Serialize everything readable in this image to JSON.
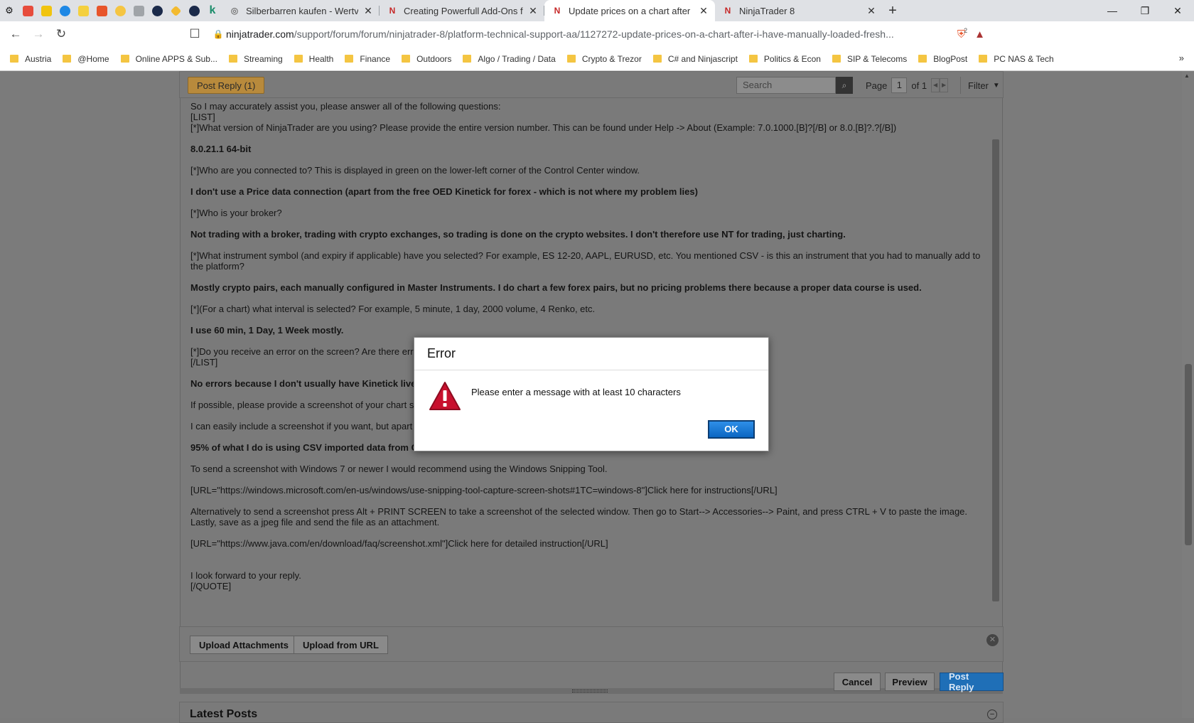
{
  "tabs": [
    {
      "title": "Silberbarren kaufen - Wertvolle Sil",
      "active": false
    },
    {
      "title": "Creating Powerfull Add-Ons for Ni",
      "active": false
    },
    {
      "title": "Update prices on a chart after I ha",
      "active": true
    },
    {
      "title": "NinjaTrader 8",
      "active": false
    }
  ],
  "omnibox": {
    "host": "ninjatrader.com",
    "path": "/support/forum/forum/ninjatrader-8/platform-technical-support-aa/1127272-update-prices-on-a-chart-after-i-have-manually-loaded-fresh...",
    "brave_count": "2"
  },
  "bookmarks": [
    "Austria",
    "@Home",
    "Online APPS & Sub...",
    "Streaming",
    "Health",
    "Finance",
    "Outdoors",
    "Algo / Trading / Data",
    "Crypto & Trezor",
    "C# and Ninjascript",
    "Politics & Econ",
    "SIP & Telecoms",
    "BlogPost",
    "PC NAS & Tech"
  ],
  "forum": {
    "post_reply_tab": "Post Reply (1)",
    "search_placeholder": "Search",
    "page_label": "Page",
    "page_current": "1",
    "page_of": "of 1",
    "filter_label": "Filter"
  },
  "editor_lines": [
    {
      "text": "So I may accurately assist you, please answer all of the following questions:",
      "bold": false,
      "gap": false
    },
    {
      "text": "[LIST]",
      "bold": false,
      "gap": false
    },
    {
      "text": "[*]What version of NinjaTrader are you using? Please provide the entire version number. This can be found under Help -> About (Example: 7.0.1000.[B]?[/B] or 8.0.[B]?.?[/B])",
      "bold": false,
      "gap": true
    },
    {
      "text": "8.0.21.1 64-bit",
      "bold": true,
      "gap": true
    },
    {
      "text": "[*]Who are you connected to? This is displayed in green on the lower-left corner of the Control Center window.",
      "bold": false,
      "gap": true
    },
    {
      "text": "I don't use a Price data connection (apart from the free OED Kinetick for forex - which is not where my problem lies)",
      "bold": true,
      "gap": true
    },
    {
      "text": "[*]Who is your broker?",
      "bold": false,
      "gap": true
    },
    {
      "text": "Not trading with a broker, trading with crypto exchanges, so trading is done on the crypto websites.  I don't therefore use NT for trading, just charting.",
      "bold": true,
      "gap": true
    },
    {
      "text": "[*]What instrument symbol (and expiry if applicable) have you selected? For example, ES 12-20, AAPL, EURUSD, etc. You mentioned CSV - is this an instrument that you had to manually add to the platform?",
      "bold": false,
      "gap": true
    },
    {
      "text": "Mostly crypto pairs, each manually configured in Master Instruments.  I do chart a few forex pairs, but no pricing problems there because a proper data course is used.",
      "bold": true,
      "gap": true
    },
    {
      "text": "[*](For a chart) what interval is selected? For example, 5 minute, 1 day, 2000 volume, 4 Renko, etc.",
      "bold": false,
      "gap": true
    },
    {
      "text": "I use 60 min, 1 Day, 1 Week mostly.",
      "bold": true,
      "gap": true
    },
    {
      "text": "[*]Do you receive an error on the screen? Are there err",
      "bold": false,
      "gap": false
    },
    {
      "text": "[/LIST]",
      "bold": false,
      "gap": true
    },
    {
      "text": "No errors because I don't usually have Kinetick live                                                                                                                                  fined as \"stock\".  I just ignore those errors.",
      "bold": true,
      "gap": true
    },
    {
      "text": "If possible, please provide a screenshot of your chart s",
      "bold": false,
      "gap": true
    },
    {
      "text": "I can easily include a screenshot if you want, but apart",
      "bold": false,
      "gap": true
    },
    {
      "text": "95% of what I do is using CSV imported data from C",
      "bold": true,
      "gap": true
    },
    {
      "text": "To send a screenshot with Windows 7 or newer I would recommend using the Windows Snipping Tool.",
      "bold": false,
      "gap": true
    },
    {
      "text": "[URL=\"https://windows.microsoft.com/en-us/windows/use-snipping-tool-capture-screen-shots#1TC=windows-8\"]Click here for instructions[/URL]",
      "bold": false,
      "gap": true
    },
    {
      "text": "Alternatively to send a screenshot press Alt + PRINT SCREEN to take a screenshot of the selected window. Then go to Start--> Accessories--> Paint, and press CTRL + V to paste the image. Lastly, save as a jpeg file and send the file as an attachment.",
      "bold": false,
      "gap": true
    },
    {
      "text": "[URL=\"https://www.java.com/en/download/faq/screenshot.xml\"]Click here for detailed instruction[/URL]",
      "bold": false,
      "gap": true
    },
    {
      "text": "",
      "bold": false,
      "gap": false
    },
    {
      "text": "I look forward to your reply.",
      "bold": false,
      "gap": false
    },
    {
      "text": "[/QUOTE]",
      "bold": false,
      "gap": false
    }
  ],
  "attach": {
    "upload_attachments": "Upload Attachments",
    "upload_url": "Upload from URL"
  },
  "actions": {
    "cancel": "Cancel",
    "preview": "Preview",
    "post_reply": "Post Reply"
  },
  "latest_posts": "Latest Posts",
  "dialog": {
    "title": "Error",
    "message": "Please enter a message with at least 10 characters",
    "ok": "OK"
  },
  "colors": {
    "ok_button": "#0a66c2",
    "post_reply_button": "#1f6fb7",
    "warn_red": "#c8102e",
    "overlay": "#7b7b7b"
  }
}
